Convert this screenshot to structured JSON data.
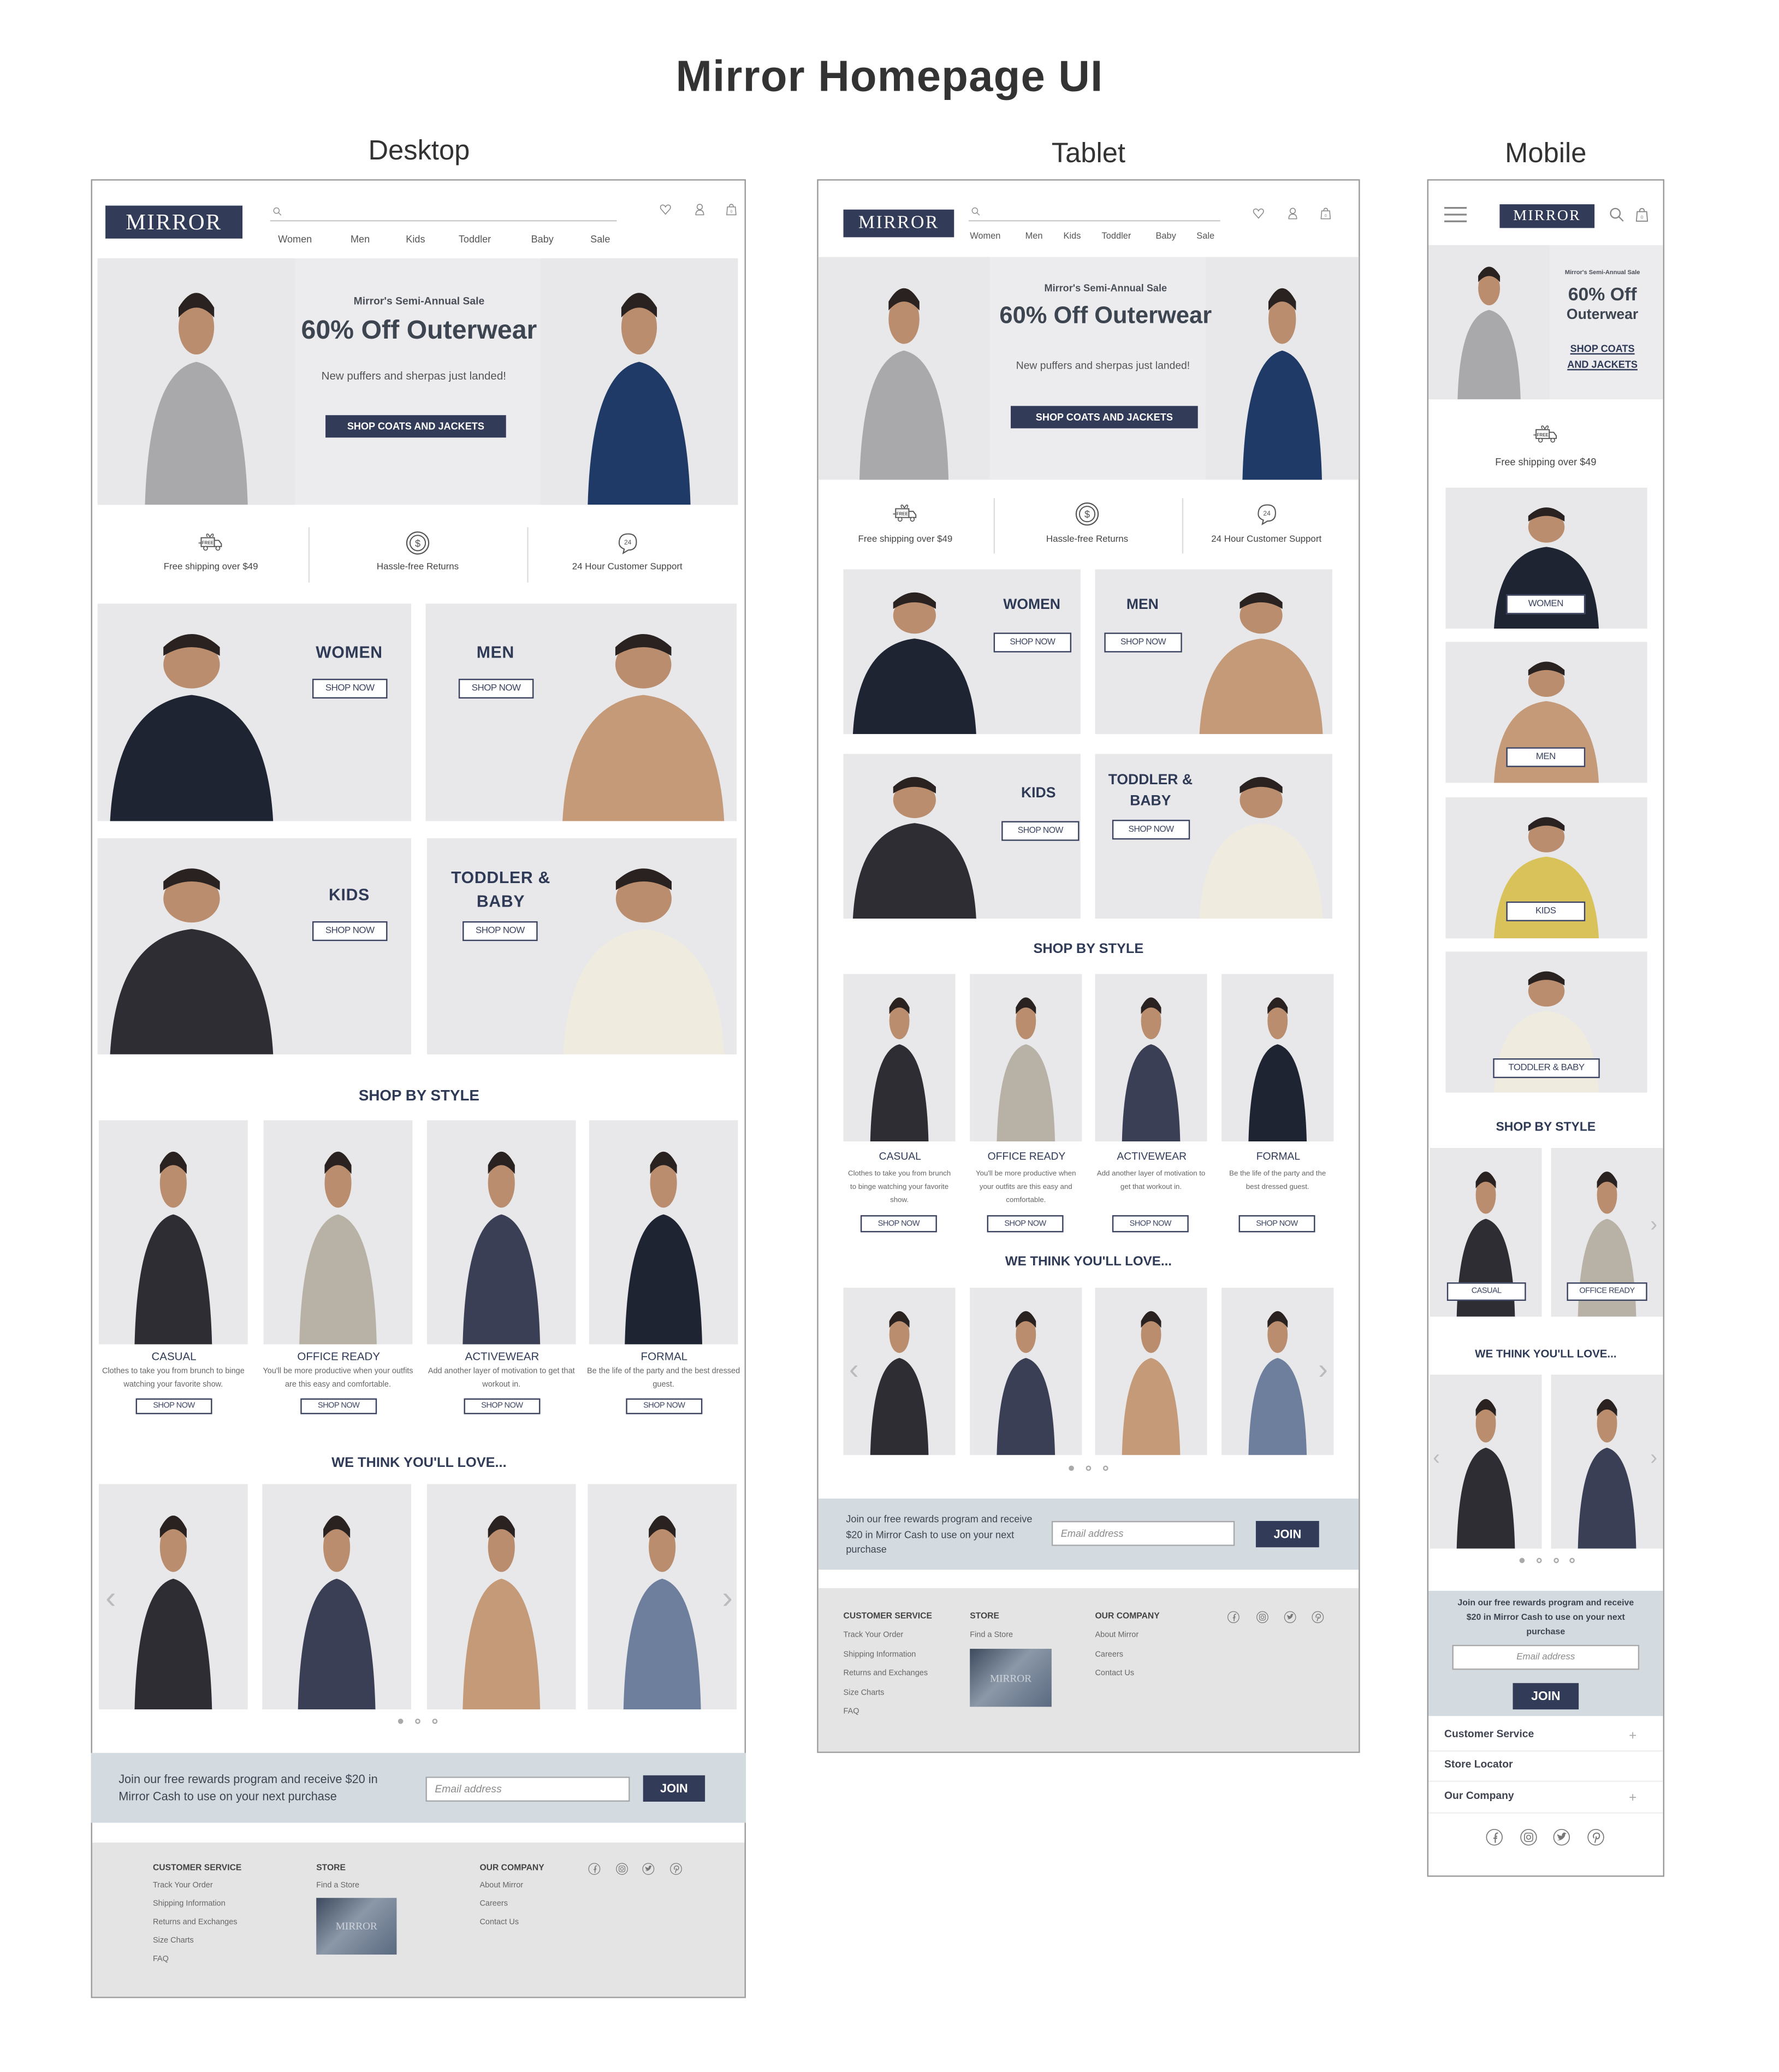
{
  "page_title": "Mirror Homepage UI",
  "labels": {
    "desktop": "Desktop",
    "tablet": "Tablet",
    "mobile": "Mobile"
  },
  "brand": {
    "logo": "MIRROR",
    "navy": "#323c58",
    "rewards_bg": "#d4dbe0",
    "footer_bg": "#e4e4e4"
  },
  "nav": [
    "Women",
    "Men",
    "Kids",
    "Toddler",
    "Baby",
    "Sale"
  ],
  "header_icons": [
    "menu-icon",
    "search-icon",
    "heart-icon",
    "user-icon",
    "bag-icon"
  ],
  "bag_count": "0",
  "hero": {
    "eyebrow": "Mirror's Semi-Annual Sale",
    "title": "60% Off Outerwear",
    "title_line1": "60% Off",
    "title_line2": "Outerwear",
    "text": "New puffers and sherpas just landed!",
    "cta": "SHOP COATS AND JACKETS",
    "cta_line1": "SHOP COATS",
    "cta_line2": "AND JACKETS"
  },
  "features": [
    {
      "icon": "free-shipping-truck-icon",
      "label": "Free shipping over $49",
      "badge": "FREE"
    },
    {
      "icon": "dollar-returns-icon",
      "label": "Hassle-free Returns"
    },
    {
      "icon": "24-hour-support-icon",
      "label": "24 Hour Customer Support"
    }
  ],
  "categories": [
    {
      "label": "WOMEN",
      "cta": "SHOP NOW"
    },
    {
      "label": "MEN",
      "cta": "SHOP NOW"
    },
    {
      "label": "KIDS",
      "cta": "SHOP NOW"
    },
    {
      "label": "TODDLER & BABY",
      "cta": "SHOP NOW"
    }
  ],
  "shop_by_style": {
    "heading": "SHOP BY STYLE",
    "items": [
      {
        "title": "CASUAL",
        "desc": "Clothes to take you from brunch to binge watching your favorite show.",
        "cta": "SHOP NOW"
      },
      {
        "title": "OFFICE READY",
        "desc": "You'll be more productive when your outfits are this easy and comfortable.",
        "cta": "SHOP NOW"
      },
      {
        "title": "ACTIVEWEAR",
        "desc": "Add another layer of motivation to get that workout in.",
        "cta": "SHOP NOW"
      },
      {
        "title": "FORMAL",
        "desc": "Be the life of the party and the best dressed guest.",
        "cta": "SHOP NOW"
      }
    ]
  },
  "recommendations": {
    "heading": "WE THINK YOU'LL LOVE...",
    "active_dot": 1
  },
  "rewards": {
    "text": "Join our free rewards program and receive $20 in Mirror Cash to use on your next purchase",
    "placeholder": "Email address",
    "cta": "JOIN"
  },
  "footer": {
    "columns": [
      {
        "heading": "CUSTOMER SERVICE",
        "links": [
          "Track Your Order",
          "Shipping Information",
          "Returns and Exchanges",
          "Size Charts",
          "FAQ"
        ]
      },
      {
        "heading": "STORE",
        "links": [
          "Find a Store"
        ]
      },
      {
        "heading": "OUR COMPANY",
        "links": [
          "About Mirror",
          "Careers",
          "Contact Us"
        ]
      }
    ],
    "store_image_text": "MIRROR",
    "social": [
      "facebook-icon",
      "instagram-icon",
      "twitter-icon",
      "pinterest-icon"
    ]
  },
  "mobile_footer": {
    "accordion": [
      "Customer Service",
      "Store Locator",
      "Our Company"
    ]
  }
}
